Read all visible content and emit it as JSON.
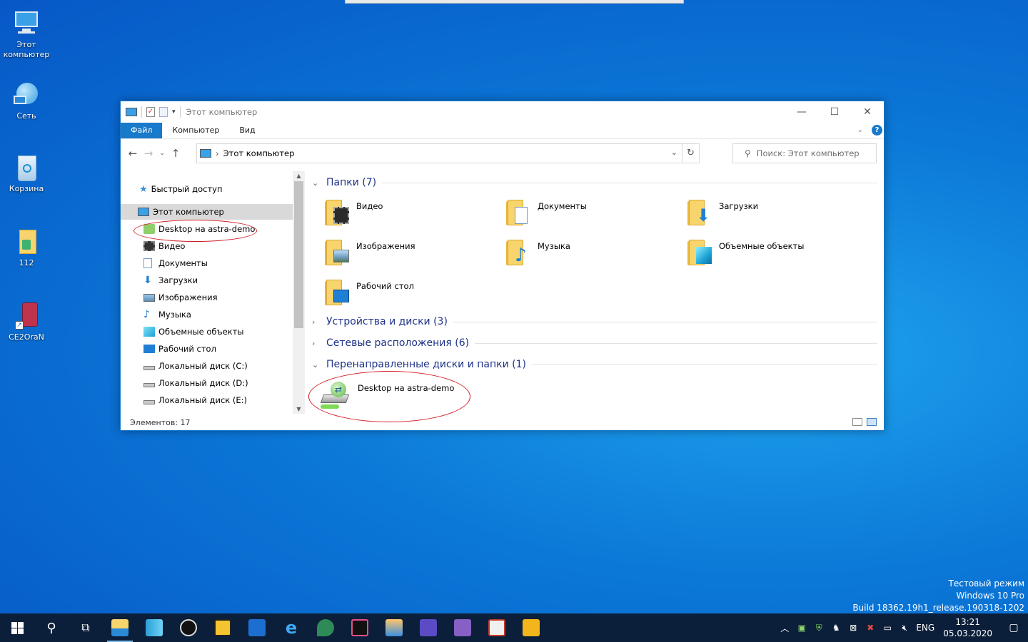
{
  "desktop": {
    "icons": [
      {
        "label": "Этот компьютер",
        "icon": "this-pc-icon"
      },
      {
        "label": "Сеть",
        "icon": "network-icon"
      },
      {
        "label": "Корзина",
        "icon": "recycle-bin-icon"
      },
      {
        "label": "112",
        "icon": "file-icon"
      },
      {
        "label": "CE2OraN",
        "icon": "shortcut-icon"
      }
    ],
    "watermark": {
      "line1": "Тестовый режим",
      "line2": "Windows 10 Pro",
      "line3": "Build 18362.19h1_release.190318-1202"
    }
  },
  "window": {
    "title": "Этот компьютер",
    "ribbon_tabs": [
      "Файл",
      "Компьютер",
      "Вид"
    ],
    "address": "Этот компьютер",
    "search_placeholder": "Поиск: Этот компьютер",
    "status": "Элементов: 17",
    "nav": {
      "quick_access": "Быстрый доступ",
      "this_pc": "Этот компьютер",
      "items": [
        "Desktop на astra-demo",
        "Видео",
        "Документы",
        "Загрузки",
        "Изображения",
        "Музыка",
        "Объемные объекты",
        "Рабочий стол",
        "Локальный диск (C:)",
        "Локальный диск (D:)",
        "Локальный диск (E:)"
      ]
    },
    "groups": {
      "folders": "Папки (7)",
      "devices": "Устройства и диски (3)",
      "network": "Сетевые расположения (6)",
      "redirected": "Перенаправленные диски и папки (1)"
    },
    "folders": [
      {
        "label": "Видео",
        "icon": "video-folder-icon"
      },
      {
        "label": "Документы",
        "icon": "documents-folder-icon"
      },
      {
        "label": "Загрузки",
        "icon": "downloads-folder-icon"
      },
      {
        "label": "Изображения",
        "icon": "pictures-folder-icon"
      },
      {
        "label": "Музыка",
        "icon": "music-folder-icon"
      },
      {
        "label": "Объемные объекты",
        "icon": "3d-objects-folder-icon"
      },
      {
        "label": "Рабочий стол",
        "icon": "desktop-folder-icon"
      }
    ],
    "redirected_items": [
      {
        "label": "Desktop на astra-demo",
        "icon": "redirected-drive-icon"
      }
    ]
  },
  "taskbar": {
    "language": "ENG",
    "time": "13:21",
    "date": "05.03.2020"
  },
  "colors": {
    "accent": "#1979ca",
    "group_header": "#1e3287",
    "annotation": "#d01e25"
  }
}
